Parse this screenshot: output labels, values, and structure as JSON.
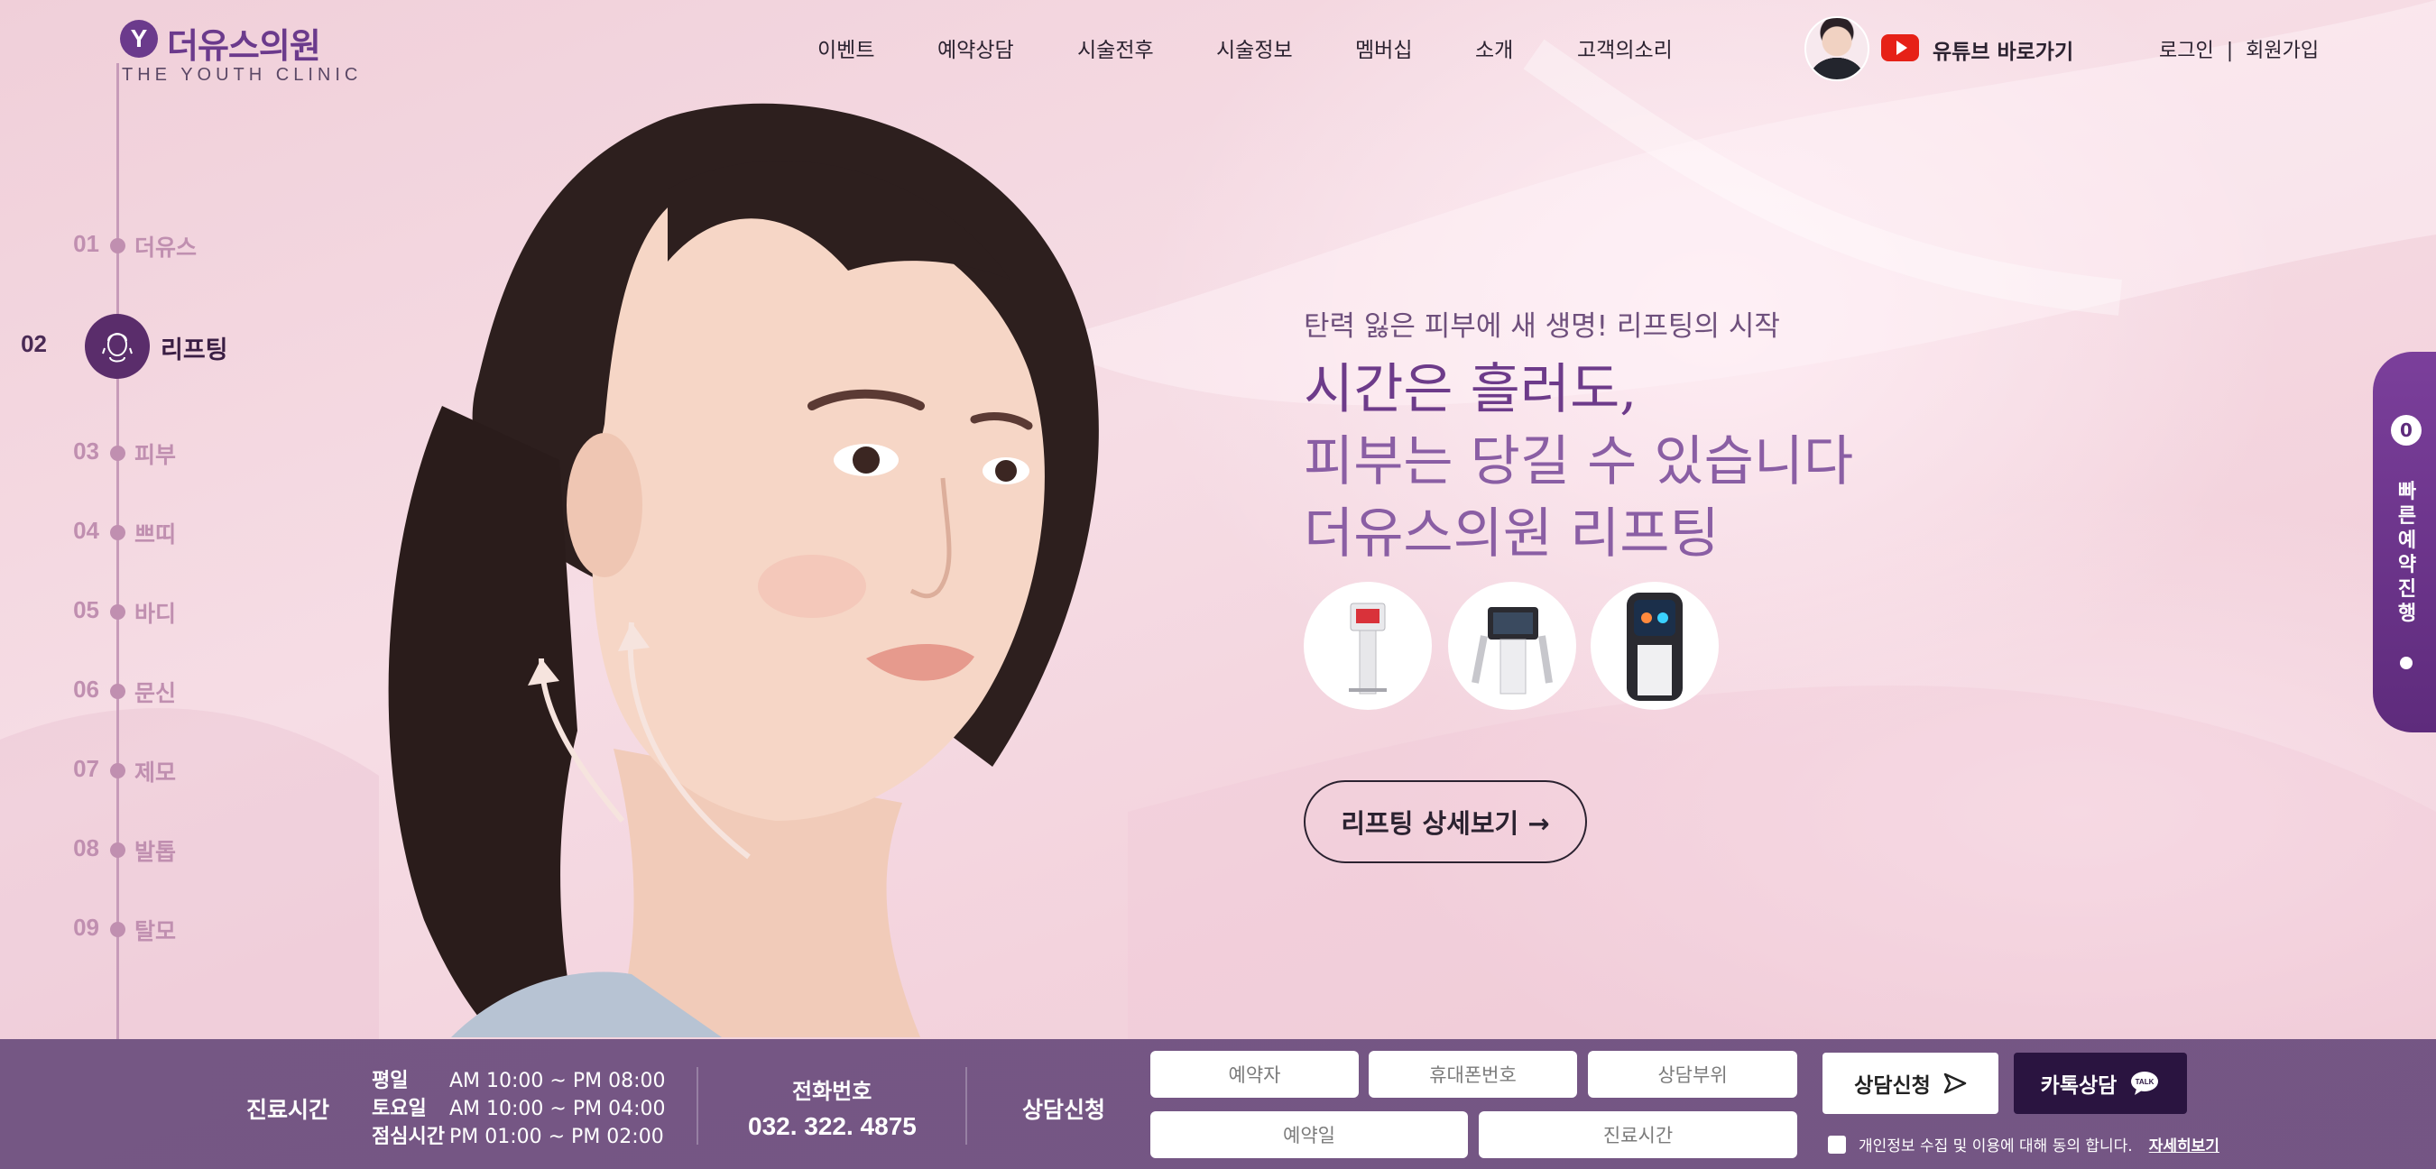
{
  "brand": {
    "logo_letter": "Y",
    "name_ko": "더유스의원",
    "name_en": "THE YOUTH CLINIC",
    "color": "#6b3a8c"
  },
  "nav": {
    "items": [
      "이벤트",
      "예약상담",
      "시술전후",
      "시술정보",
      "멤버십",
      "소개",
      "고객의소리"
    ]
  },
  "header_right": {
    "youtube_label": "유튜브 바로가기",
    "login": "로그인",
    "separator": "|",
    "signup": "회원가입"
  },
  "side_nav": {
    "active_index": 1,
    "items": [
      {
        "num": "01",
        "label": "더유스"
      },
      {
        "num": "02",
        "label": "리프팅"
      },
      {
        "num": "03",
        "label": "피부"
      },
      {
        "num": "04",
        "label": "쁘띠"
      },
      {
        "num": "05",
        "label": "바디"
      },
      {
        "num": "06",
        "label": "문신"
      },
      {
        "num": "07",
        "label": "제모"
      },
      {
        "num": "08",
        "label": "발톱"
      },
      {
        "num": "09",
        "label": "탈모"
      }
    ]
  },
  "hero": {
    "subtitle": "탄력 잃은 피부에 새 생명! 리프팅의 시작",
    "title_lines": [
      "시간은 흘러도,",
      "피부는 당길 수 있습니다",
      "더유스의원 리프팅"
    ],
    "cta": "리프팅 상세보기 →",
    "devices": [
      "device-1",
      "device-2",
      "device-3"
    ]
  },
  "quick_reserve": {
    "count": "0",
    "label": "빠른예약진행"
  },
  "footer_bar": {
    "hours_title": "진료시간",
    "hours": [
      {
        "day": "평일",
        "time": "AM 10:00 ~ PM 08:00"
      },
      {
        "day": "토요일",
        "time": "AM 10:00 ~ PM 04:00"
      },
      {
        "day": "점심시간",
        "time": "PM 01:00 ~ PM 02:00"
      }
    ],
    "phone_title": "전화번호",
    "phone": "032. 322. 4875",
    "consult_title": "상담신청",
    "fields": {
      "name": "예약자",
      "mobile": "휴대폰번호",
      "area": "상담부위",
      "date": "예약일",
      "time": "진료시간"
    },
    "submit": "상담신청",
    "kakao": "카톡상담",
    "kakao_badge": "TALK",
    "agree_text": "개인정보 수집 및 이용에 대해 동의 합니다.",
    "agree_more": "자세히보기"
  }
}
